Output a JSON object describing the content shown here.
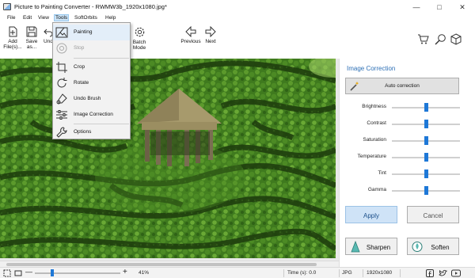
{
  "window": {
    "title": "Picture to Painting Converter - RWMW3b_1920x1080.jpg*",
    "minimize": "—",
    "maximize": "□",
    "close": "✕"
  },
  "menu": [
    "File",
    "Edit",
    "View",
    "Tools",
    "SoftOrbits",
    "Help"
  ],
  "toolbar": {
    "add_label_1": "Add",
    "add_label_2": "File(s)...",
    "save_label_1": "Save",
    "save_label_2": "as...",
    "undo_label": "Und",
    "batch_label_1": "Batch",
    "batch_label_2": "Mode",
    "previous_label": "Previous",
    "next_label": "Next"
  },
  "tools_menu": {
    "items": [
      {
        "label": "Painting",
        "icon": "painting-icon",
        "enabled": true
      },
      {
        "label": "Stop",
        "icon": "stop-icon",
        "enabled": false
      },
      {
        "label": "Crop",
        "icon": "crop-icon",
        "enabled": true
      },
      {
        "label": "Rotate",
        "icon": "rotate-icon",
        "enabled": true
      },
      {
        "label": "Undo Brush",
        "icon": "undo-brush-icon",
        "enabled": true
      },
      {
        "label": "Image Correction",
        "icon": "image-correction-icon",
        "enabled": true
      },
      {
        "label": "Options",
        "icon": "options-icon",
        "enabled": true
      }
    ]
  },
  "panel": {
    "title": "Image Correction",
    "auto_correction": "Auto correction",
    "sliders": [
      {
        "label": "Brightness",
        "value": 0.5
      },
      {
        "label": "Contrast",
        "value": 0.5
      },
      {
        "label": "Saturation",
        "value": 0.5
      },
      {
        "label": "Temperature",
        "value": 0.5
      },
      {
        "label": "Tint",
        "value": 0.5
      },
      {
        "label": "Gamma",
        "value": 0.5
      }
    ],
    "apply": "Apply",
    "cancel": "Cancel",
    "sharpen": "Sharpen",
    "soften": "Soften"
  },
  "status": {
    "zoom": "41%",
    "zoom_fraction": 0.2,
    "time": "Time (s): 0.0",
    "format": "JPG",
    "dimensions": "1920x1080"
  },
  "colors": {
    "accent": "#1e78d7",
    "panel_title": "#2c6fb5",
    "menu_highlight": "#cce4f7"
  }
}
